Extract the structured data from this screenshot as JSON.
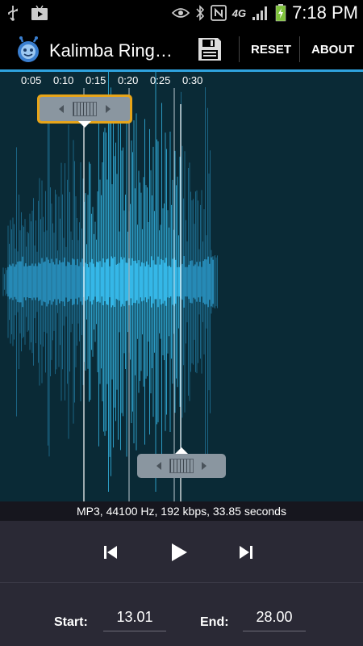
{
  "status_bar": {
    "time": "7:18 PM",
    "network": "4G",
    "icons": [
      "usb-icon",
      "play-store-icon",
      "eye-icon",
      "bluetooth-icon",
      "nfc-icon",
      "signal-icon",
      "battery-charging-icon"
    ]
  },
  "action_bar": {
    "title": "Kalimba Ring…",
    "save_icon": "save-icon",
    "reset_label": "RESET",
    "about_label": "ABOUT",
    "accent_color": "#2fa3df"
  },
  "timeline": {
    "ticks": [
      "0:05",
      "0:10",
      "0:15",
      "0:20",
      "0:25",
      "0:30"
    ]
  },
  "waveform": {
    "background_color": "#0a2a36",
    "wave_color": "#2a93c2",
    "selected_color": "#38bff0",
    "marker_color": "#e8a519"
  },
  "info": {
    "text": "MP3, 44100 Hz, 192 kbps, 33.85 seconds"
  },
  "playback": {
    "prev_icon": "skip-previous-icon",
    "play_icon": "play-icon",
    "next_icon": "skip-next-icon"
  },
  "selection": {
    "start_label": "Start:",
    "start_value": "13.01",
    "end_label": "End:",
    "end_value": "28.00"
  }
}
